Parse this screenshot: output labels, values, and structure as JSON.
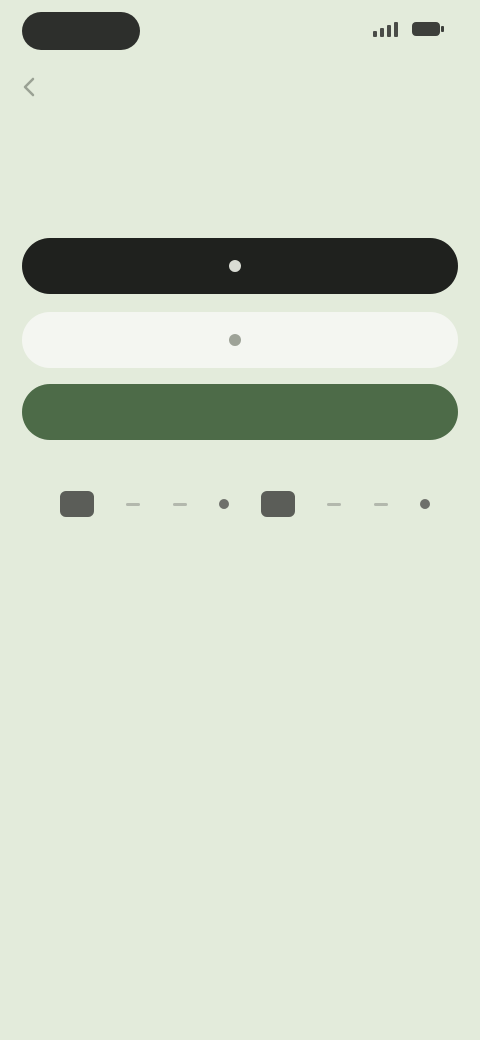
{
  "status_bar": {
    "time": "",
    "battery_icon": "battery-icon",
    "signal_icon": "signal-icon"
  },
  "header": {
    "back_icon": "chevron-left-icon",
    "title": "",
    "subtitle": ""
  },
  "buttons": {
    "dark_label": "",
    "light_label": "",
    "green_label": ""
  },
  "pager": {
    "items": [
      "block",
      "dash",
      "dash",
      "dot",
      "block",
      "dash",
      "dash",
      "dot"
    ]
  },
  "footer": {
    "text": "",
    "link": ""
  },
  "colors": {
    "background": "#e3ebdb",
    "dark_button": "#1f211e",
    "light_button": "#f4f6f1",
    "accent_green": "#4d6b48"
  }
}
